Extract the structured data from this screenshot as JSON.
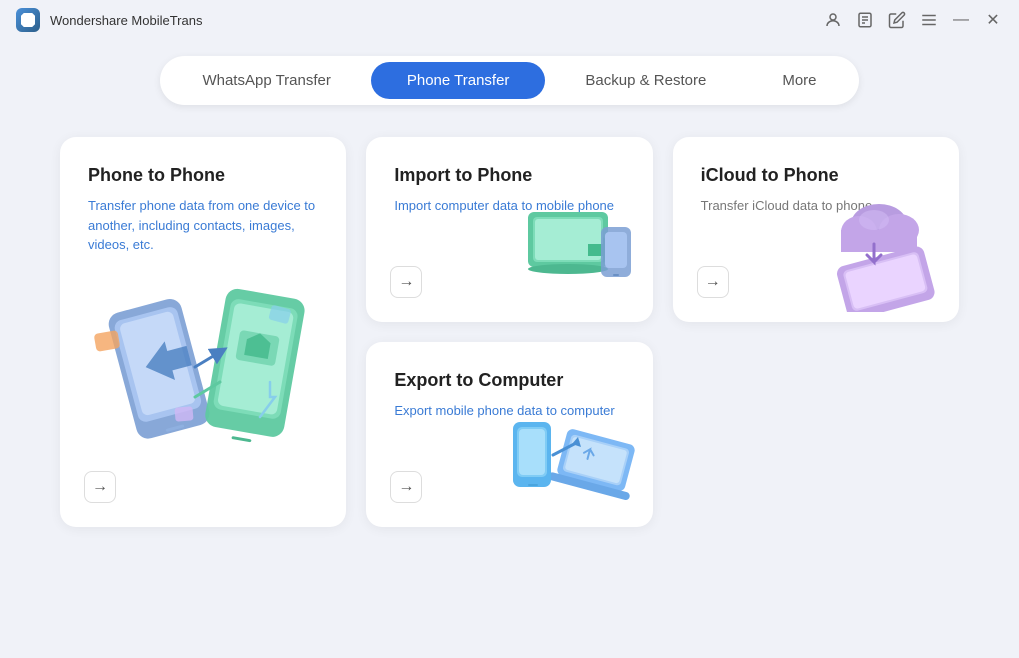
{
  "app": {
    "name": "Wondershare MobileTrans",
    "icon_label": "mobiletrans-icon"
  },
  "titlebar": {
    "controls": {
      "account": "👤",
      "bookmark": "🔖",
      "edit": "✏️",
      "menu": "☰",
      "minimize": "—",
      "close": "✕"
    }
  },
  "nav": {
    "tabs": [
      {
        "id": "whatsapp",
        "label": "WhatsApp Transfer",
        "active": false
      },
      {
        "id": "phone",
        "label": "Phone Transfer",
        "active": true
      },
      {
        "id": "backup",
        "label": "Backup & Restore",
        "active": false
      },
      {
        "id": "more",
        "label": "More",
        "active": false
      }
    ]
  },
  "cards": {
    "phone_to_phone": {
      "title": "Phone to Phone",
      "desc": "Transfer phone data from one device to another, including contacts, images, videos, etc.",
      "arrow": "→"
    },
    "import_to_phone": {
      "title": "Import to Phone",
      "desc": "Import computer data to mobile phone",
      "arrow": "→"
    },
    "icloud_to_phone": {
      "title": "iCloud to Phone",
      "desc": "Transfer iCloud data to phone",
      "arrow": "→"
    },
    "export_to_computer": {
      "title": "Export to Computer",
      "desc": "Export mobile phone data to computer",
      "arrow": "→"
    }
  },
  "colors": {
    "active_tab": "#2d6ee0",
    "card_bg": "#ffffff",
    "desc_blue": "#3a7bd5",
    "desc_gray": "#777777"
  }
}
